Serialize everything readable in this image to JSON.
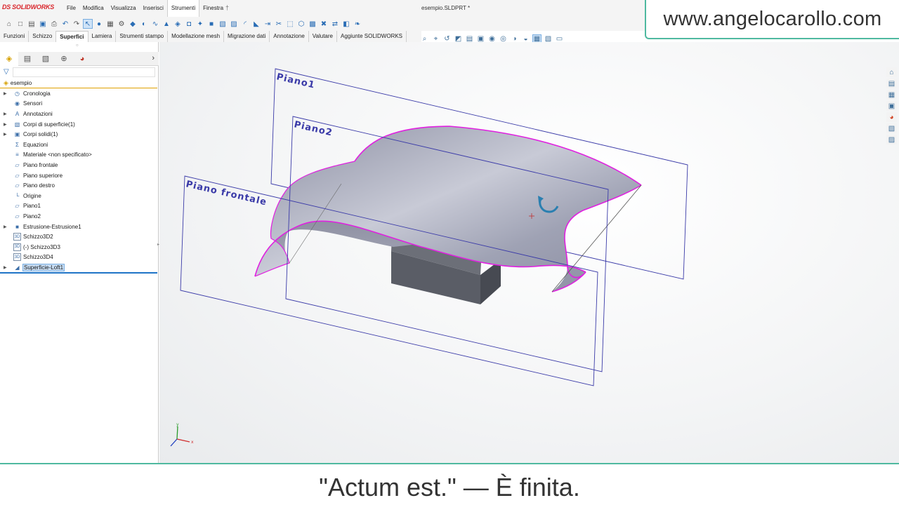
{
  "app": {
    "logo_text": "SOLIDWORKS",
    "logo_mark": "DS",
    "document_title": "esempio.SLDPRT *"
  },
  "menu": [
    "File",
    "Modifica",
    "Visualizza",
    "Inserisci",
    "Strumenti",
    "Finestra"
  ],
  "menu_active": "Strumenti",
  "command_tabs": [
    "Funzioni",
    "Schizzo",
    "Superfici",
    "Lamiera",
    "Strumenti stampo",
    "Modellazione mesh",
    "Migrazione dati",
    "Annotazione",
    "Valutare",
    "Aggiunte SOLIDWORKS"
  ],
  "command_tab_active": "Superfici",
  "feature_tree": {
    "root": "esempio",
    "items": [
      {
        "label": "Cronologia",
        "icon": "history-icon",
        "expandable": true
      },
      {
        "label": "Sensori",
        "icon": "sensor-icon",
        "expandable": false
      },
      {
        "label": "Annotazioni",
        "icon": "annotation-icon",
        "expandable": true
      },
      {
        "label": "Corpi di superficie(1)",
        "icon": "surface-bodies-icon",
        "expandable": true
      },
      {
        "label": "Corpi solidi(1)",
        "icon": "solid-bodies-icon",
        "expandable": true
      },
      {
        "label": "Equazioni",
        "icon": "equation-icon",
        "expandable": false
      },
      {
        "label": "Materiale <non specificato>",
        "icon": "material-icon",
        "expandable": false
      },
      {
        "label": "Piano frontale",
        "icon": "plane-icon",
        "expandable": false
      },
      {
        "label": "Piano superiore",
        "icon": "plane-icon",
        "expandable": false
      },
      {
        "label": "Piano destro",
        "icon": "plane-icon",
        "expandable": false
      },
      {
        "label": "Origine",
        "icon": "origin-icon",
        "expandable": false
      },
      {
        "label": "Piano1",
        "icon": "plane-icon",
        "expandable": false
      },
      {
        "label": "Piano2",
        "icon": "plane-icon",
        "expandable": false
      },
      {
        "label": "Estrusione-Estrusione1",
        "icon": "extrude-icon",
        "expandable": true
      },
      {
        "label": "Schizzo3D2",
        "icon": "sketch3d-icon",
        "expandable": false
      },
      {
        "label": "(-) Schizzo3D3",
        "icon": "sketch3d-icon",
        "expandable": false
      },
      {
        "label": "Schizzo3D4",
        "icon": "sketch3d-icon",
        "expandable": false
      },
      {
        "label": "Superficie-Loft1",
        "icon": "loft-surface-icon",
        "expandable": true,
        "selected": true
      }
    ]
  },
  "viewport": {
    "plane_labels": [
      "Piano1",
      "Piano2",
      "Piano frontale"
    ],
    "triad_x": "x",
    "triad_y": "y",
    "colors": {
      "plane_edge": "#3a3aa8",
      "selected_edge": "#e020e0",
      "surface": "#9a9cae",
      "block": "#5a5d66"
    }
  },
  "watermark": "www.angelocarollo.com",
  "subtitle": "\"Actum est.\" — È finita."
}
